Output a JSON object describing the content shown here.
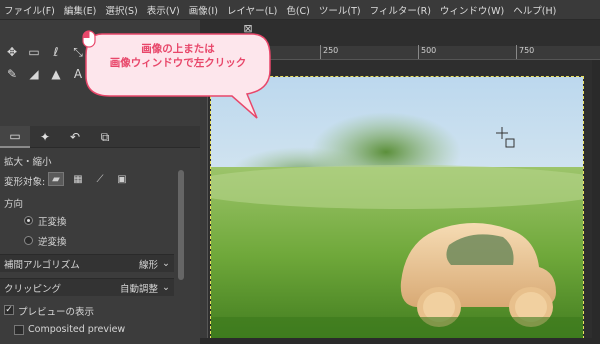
{
  "menu": [
    "ファイル(F)",
    "編集(E)",
    "選択(S)",
    "表示(V)",
    "画像(I)",
    "レイヤー(L)",
    "色(C)",
    "ツール(T)",
    "フィルター(R)",
    "ウィンドウ(W)",
    "ヘルプ(H)"
  ],
  "callout": {
    "line1": "画像の上または",
    "line2": "画像ウィンドウで左クリック"
  },
  "tool_options": {
    "title": "拡大・縮小",
    "transform_label": "変形対象:",
    "direction_label": "方向",
    "direction_normal": "正変換",
    "direction_reverse": "逆変換",
    "interpolation_label": "補間アルゴリズム",
    "interpolation_value": "線形",
    "clipping_label": "クリッピング",
    "clipping_value": "自動調整",
    "preview_label": "プレビューの表示",
    "composited_label": "Composited preview"
  },
  "ruler": {
    "t1": "250",
    "t2": "500",
    "t3": "750"
  },
  "colors": {
    "callout_text": "#e8476a",
    "callout_fill": "#fde6ec",
    "callout_border": "#e8476a"
  }
}
